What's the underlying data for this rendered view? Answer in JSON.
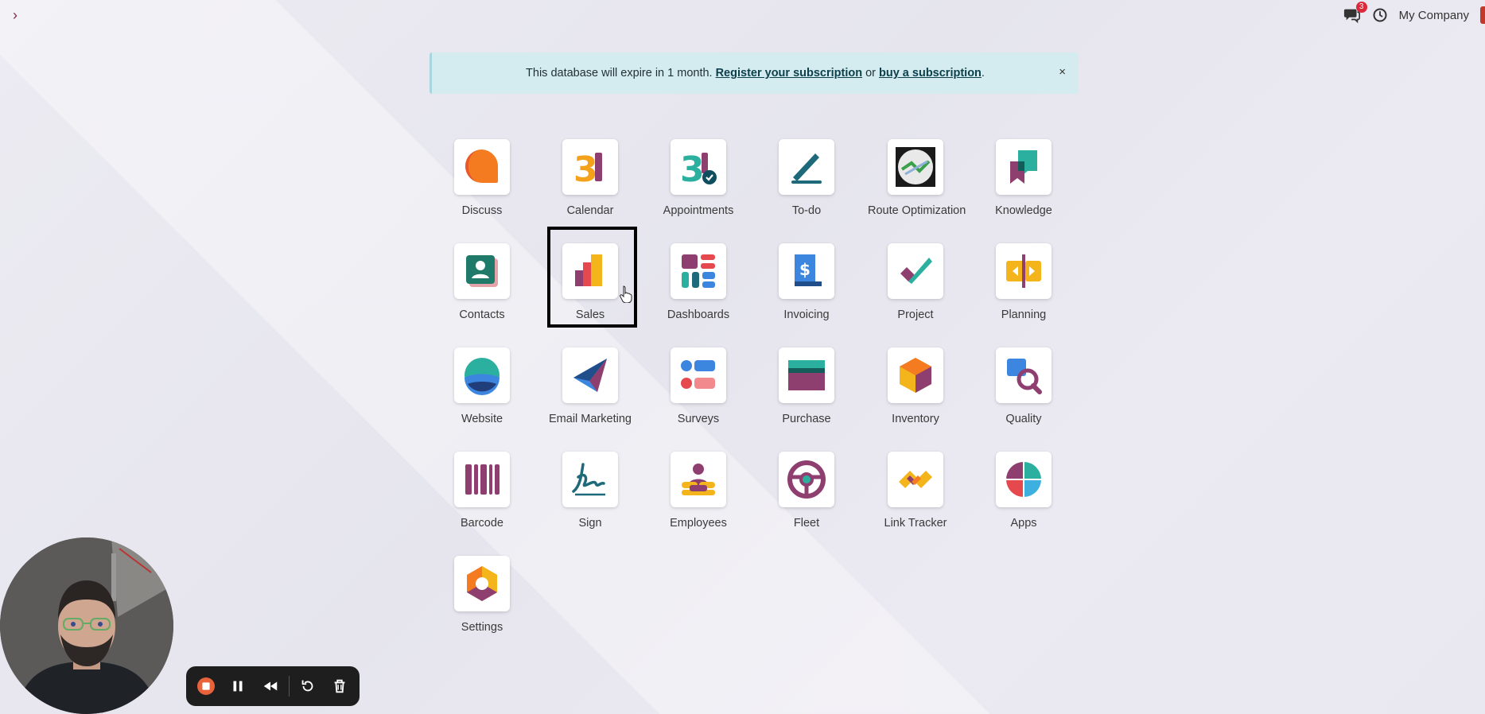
{
  "topbar": {
    "menu_glyph": "›",
    "chat_count": "3",
    "company": "My Company"
  },
  "alert": {
    "text_before": "This database will expire in 1 month.",
    "link1": "Register your subscription",
    "text_middle": "or",
    "link2": "buy a subscription",
    "text_after": ".",
    "close": "×"
  },
  "apps": [
    {
      "label": "Discuss",
      "icon": "discuss-icon"
    },
    {
      "label": "Calendar",
      "icon": "calendar-icon"
    },
    {
      "label": "Appointments",
      "icon": "appointments-icon"
    },
    {
      "label": "To-do",
      "icon": "todo-icon"
    },
    {
      "label": "Route Optimization",
      "icon": "route-optimization-icon"
    },
    {
      "label": "Knowledge",
      "icon": "knowledge-icon"
    },
    {
      "label": "Contacts",
      "icon": "contacts-icon"
    },
    {
      "label": "Sales",
      "icon": "sales-icon"
    },
    {
      "label": "Dashboards",
      "icon": "dashboards-icon"
    },
    {
      "label": "Invoicing",
      "icon": "invoicing-icon"
    },
    {
      "label": "Project",
      "icon": "project-icon"
    },
    {
      "label": "Planning",
      "icon": "planning-icon"
    },
    {
      "label": "Website",
      "icon": "website-icon"
    },
    {
      "label": "Email Marketing",
      "icon": "email-marketing-icon"
    },
    {
      "label": "Surveys",
      "icon": "surveys-icon"
    },
    {
      "label": "Purchase",
      "icon": "purchase-icon"
    },
    {
      "label": "Inventory",
      "icon": "inventory-icon"
    },
    {
      "label": "Quality",
      "icon": "quality-icon"
    },
    {
      "label": "Barcode",
      "icon": "barcode-icon"
    },
    {
      "label": "Sign",
      "icon": "sign-icon"
    },
    {
      "label": "Employees",
      "icon": "employees-icon"
    },
    {
      "label": "Fleet",
      "icon": "fleet-icon"
    },
    {
      "label": "Link Tracker",
      "icon": "link-tracker-icon"
    },
    {
      "label": "Apps",
      "icon": "apps-icon"
    },
    {
      "label": "Settings",
      "icon": "settings-icon"
    }
  ],
  "colors": {
    "brand": "#714B67",
    "alert_bg": "#d4ecf0",
    "badge": "#d9293b",
    "record": "#e8623a"
  }
}
